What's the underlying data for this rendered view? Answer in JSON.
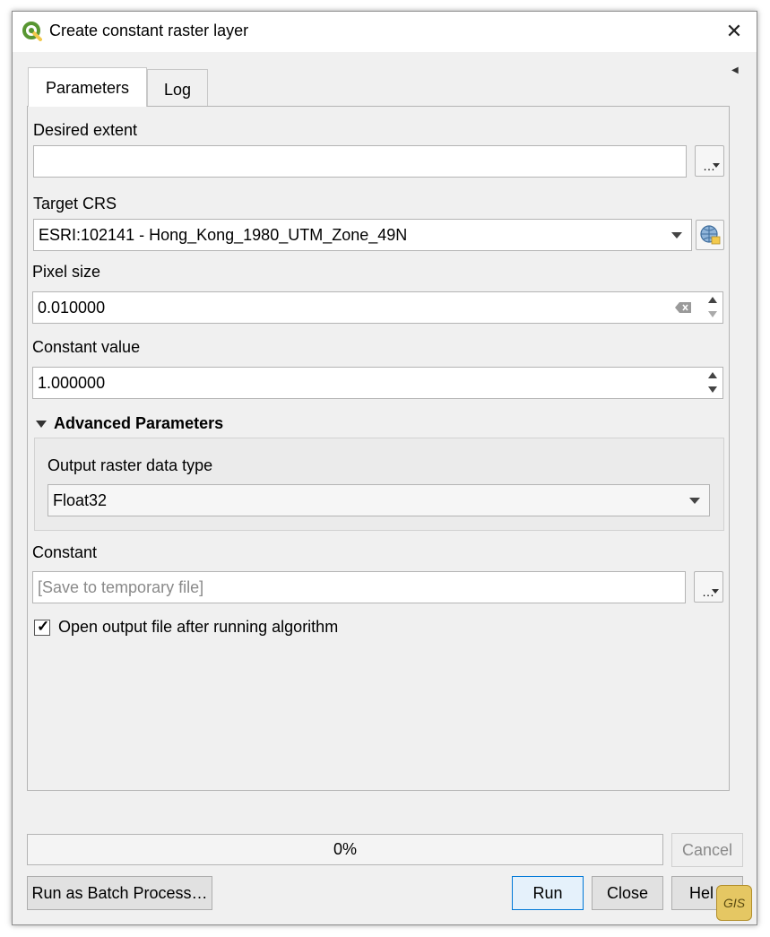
{
  "window": {
    "title": "Create constant raster layer"
  },
  "tabs": [
    {
      "label": "Parameters"
    },
    {
      "label": "Log"
    }
  ],
  "params": {
    "extent": {
      "label": "Desired extent",
      "value": ""
    },
    "crs": {
      "label": "Target CRS",
      "value": "ESRI:102141 - Hong_Kong_1980_UTM_Zone_49N"
    },
    "pixel_size": {
      "label": "Pixel size",
      "value": "0.010000"
    },
    "constant_value": {
      "label": "Constant value",
      "value": "1.000000"
    },
    "advanced": {
      "header": "Advanced Parameters",
      "output_type_label": "Output raster data type",
      "output_type_value": "Float32"
    },
    "output": {
      "label": "Constant",
      "placeholder": "[Save to temporary file]"
    },
    "open_output": {
      "label": "Open output file after running algorithm",
      "checked": true
    }
  },
  "progress": {
    "text": "0%"
  },
  "buttons": {
    "cancel": "Cancel",
    "batch": "Run as Batch Process…",
    "run": "Run",
    "close": "Close",
    "help": "Hel"
  },
  "colors": {
    "logo_green": "#589632",
    "default_button_border": "#0078d7"
  }
}
